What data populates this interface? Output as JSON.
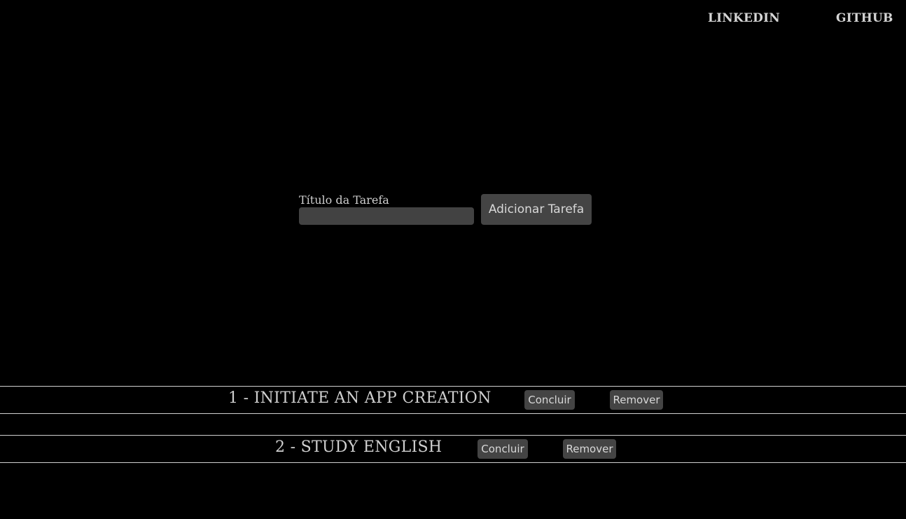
{
  "nav": {
    "links": [
      {
        "label": "LINKEDIN"
      },
      {
        "label": "GITHUB"
      }
    ]
  },
  "form": {
    "label": "Título da Tarefa",
    "input_value": "",
    "add_button_label": "Adicionar Tarefa"
  },
  "tasks": [
    {
      "text": "1 - INITIATE AN APP CREATION",
      "complete_label": "Concluir",
      "remove_label": "Remover"
    },
    {
      "text": "2 - STUDY ENGLISH",
      "complete_label": "Concluir",
      "remove_label": "Remover"
    }
  ],
  "colors": {
    "background": "#000000",
    "text": "#cfcfcf",
    "button_bg": "#444444",
    "divider": "#d0d0d0"
  }
}
